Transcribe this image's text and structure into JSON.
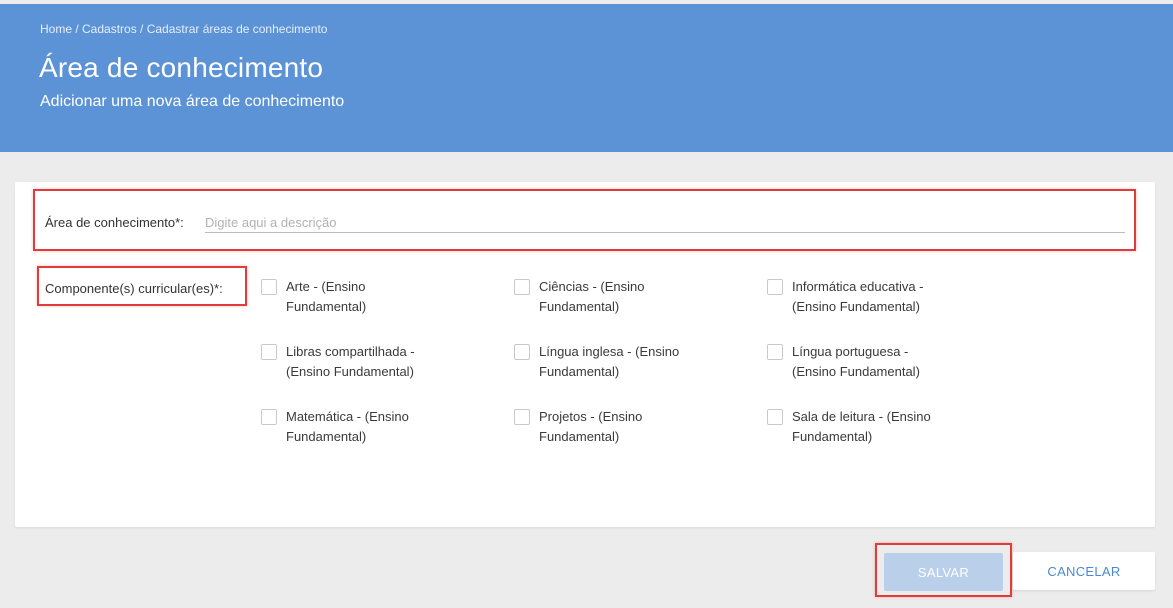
{
  "header": {
    "breadcrumb": "Home / Cadastros / Cadastrar áreas de conhecimento",
    "title": "Área de conhecimento",
    "subtitle": "Adicionar uma nova área de conhecimento"
  },
  "form": {
    "area_label": "Área de conhecimento*:",
    "area_placeholder": "Digite aqui a descrição",
    "area_value": "",
    "components_label": "Componente(s) curricular(es)*:",
    "components": [
      {
        "label": "Arte - (Ensino Fundamental)",
        "checked": false
      },
      {
        "label": "Ciências - (Ensino Fundamental)",
        "checked": false
      },
      {
        "label": "Informática educativa - (Ensino Fundamental)",
        "checked": false
      },
      {
        "label": "Libras compartilhada - (Ensino Fundamental)",
        "checked": false
      },
      {
        "label": "Língua inglesa - (Ensino Fundamental)",
        "checked": false
      },
      {
        "label": "Língua portuguesa - (Ensino Fundamental)",
        "checked": false
      },
      {
        "label": "Matemática - (Ensino Fundamental)",
        "checked": false
      },
      {
        "label": "Projetos - (Ensino Fundamental)",
        "checked": false
      },
      {
        "label": "Sala de leitura - (Ensino Fundamental)",
        "checked": false
      }
    ]
  },
  "actions": {
    "save_label": "SALVAR",
    "cancel_label": "CANCELAR"
  },
  "colors": {
    "header_bg": "#5b93d6",
    "highlight": "#e03c3c",
    "save_disabled": "#b9cfea",
    "cancel_text": "#4a8ad4"
  }
}
